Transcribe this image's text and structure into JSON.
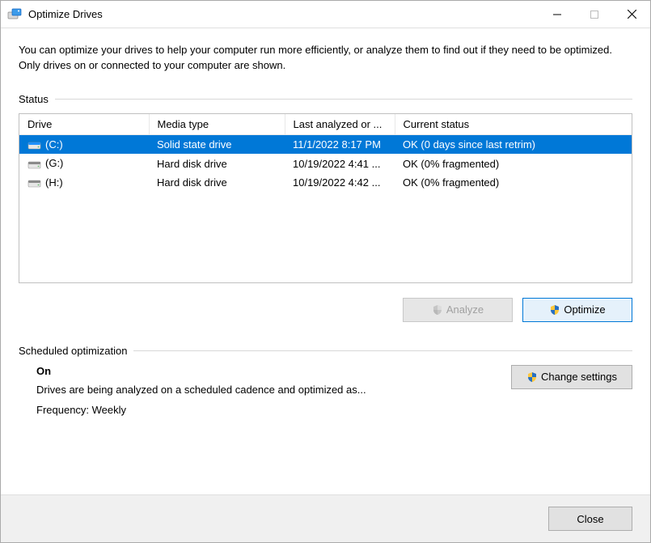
{
  "window": {
    "title": "Optimize Drives"
  },
  "description": "You can optimize your drives to help your computer run more efficiently, or analyze them to find out if they need to be optimized. Only drives on or connected to your computer are shown.",
  "status_section": {
    "label": "Status",
    "columns": {
      "drive": "Drive",
      "media": "Media type",
      "last": "Last analyzed or ...",
      "status": "Current status"
    },
    "rows": [
      {
        "drive": "(C:)",
        "media": "Solid state drive",
        "last": "11/1/2022 8:17 PM",
        "status": "OK (0 days since last retrim)",
        "selected": true,
        "iconColor": "#1e90ff"
      },
      {
        "drive": "(G:)",
        "media": "Hard disk drive",
        "last": "10/19/2022 4:41 ...",
        "status": "OK (0% fragmented)",
        "selected": false,
        "iconColor": "#8a8a8a"
      },
      {
        "drive": "(H:)",
        "media": "Hard disk drive",
        "last": "10/19/2022 4:42 ...",
        "status": "OK (0% fragmented)",
        "selected": false,
        "iconColor": "#8a8a8a"
      }
    ]
  },
  "buttons": {
    "analyze": "Analyze",
    "optimize": "Optimize",
    "change_settings": "Change settings",
    "close": "Close"
  },
  "scheduled": {
    "label": "Scheduled optimization",
    "on_label": "On",
    "desc": "Drives are being analyzed on a scheduled cadence and optimized as...",
    "freq": "Frequency: Weekly"
  }
}
